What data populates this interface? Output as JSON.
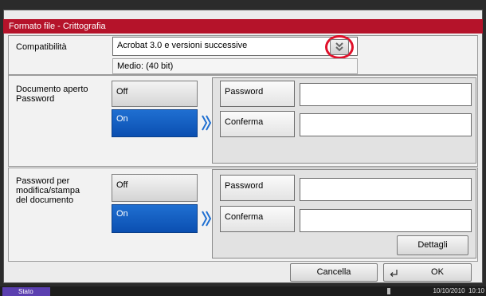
{
  "window": {
    "title": "Formato file - Crittografia"
  },
  "compatibility": {
    "label": "Compatibilità",
    "selected": "Acrobat 3.0 e versioni successive",
    "encryption_level": "Medio: (40 bit)"
  },
  "open_doc": {
    "label": "Documento aperto\nPassword",
    "off": "Off",
    "on": "On",
    "password_label": "Password",
    "confirm_label": "Conferma",
    "password_value": "",
    "confirm_value": ""
  },
  "edit_print": {
    "label": "Password per\nmodifica/stampa\ndel documento",
    "off": "Off",
    "on": "On",
    "password_label": "Password",
    "confirm_label": "Conferma",
    "password_value": "",
    "confirm_value": "",
    "details_label": "Dettagli"
  },
  "footer": {
    "cancel": "Cancella",
    "ok": "OK"
  },
  "status": {
    "label": "Stato",
    "datetime": "10/10/2010  10:10"
  },
  "colors": {
    "title_red": "#b5132a",
    "selected_blue": "#0b4fb1",
    "highlight_ring": "#e0102a"
  }
}
